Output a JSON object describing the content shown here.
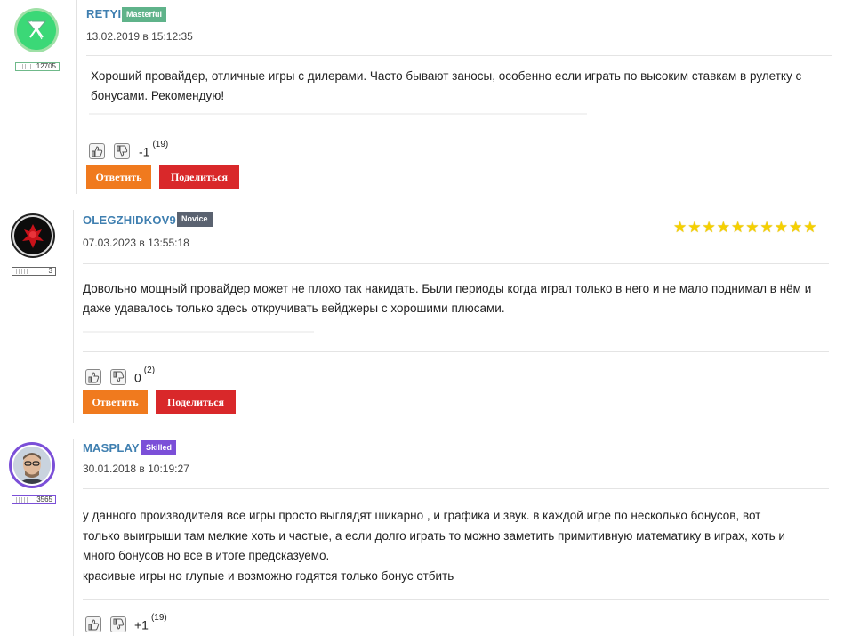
{
  "comments": [
    {
      "author": "RETYI",
      "rank": "Masterful",
      "rank_color": "#5fb38a",
      "level": "12705",
      "date": "13.02.2019 в 15:12:35",
      "text": "Хороший провайдер, отличные игры с дилерами. Часто бывают заносы, особенно если играть по высоким ставкам в рулетку с бонусами. Рекомендую!",
      "score": "-1",
      "votes": "(19)",
      "reply_label": "Ответить",
      "share_label": "Поделиться"
    },
    {
      "author": "OLEGZHIDKOV9",
      "rank": "Novice",
      "rank_color": "#5a6270",
      "level": "3",
      "date": "07.03.2023 в 13:55:18",
      "rating": 10,
      "text": "Довольно мощный провайдер может не плохо так накидать. Были периоды когда играл только в него и не мало поднимал в нём и даже удавалось только здесь откручивать вейджеры с хорошими плюсами.",
      "score": "0",
      "votes": "(2)",
      "reply_label": "Ответить",
      "share_label": "Поделиться"
    },
    {
      "author": "MASPLAY",
      "rank": "Skilled",
      "rank_color": "#7b4fd8",
      "level": "3565",
      "date": "30.01.2018 в 10:19:27",
      "text_lines": [
        "у данного производителя все игры просто выглядят шикарно , и графика и звук. в каждой игре по несколько бонусов, вот",
        "только выигрыши там мелкие хоть и частые, а если долго играть то можно заметить примитивную математику в играх, хоть и",
        "много бонусов но все в итоге предсказуемо.",
        "красивые игры но глупые и возможно годятся только бонус отбить"
      ],
      "score": "+1",
      "votes": "(19)"
    }
  ],
  "icons": {
    "like": "thumbs-up-icon",
    "dislike": "thumbs-down-icon",
    "star": "star-icon"
  }
}
